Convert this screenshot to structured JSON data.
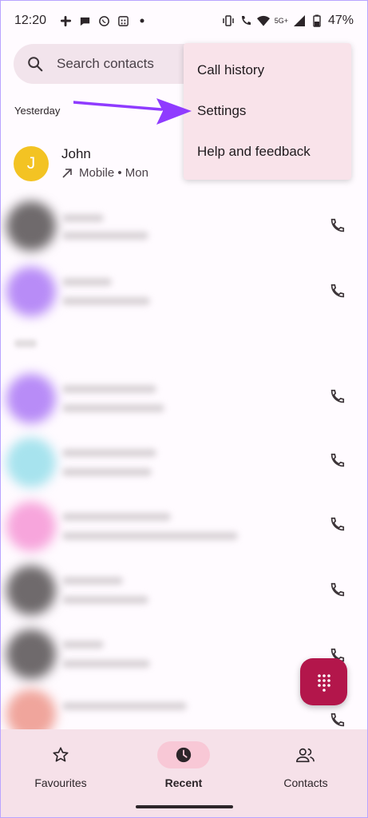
{
  "status_bar": {
    "time": "12:20",
    "network": "5G+",
    "battery": "47%",
    "icons_left": [
      "slack-icon",
      "chat-icon",
      "whatsapp-icon",
      "calendar-icon",
      "dot-icon"
    ],
    "icons_right": [
      "vibrate-icon",
      "wifi-calling-icon",
      "wifi-icon",
      "signal-icon",
      "battery-icon"
    ]
  },
  "search": {
    "placeholder": "Search contacts"
  },
  "section_label": "Yesterday",
  "recent_call": {
    "initial": "J",
    "name": "John",
    "detail": "Mobile • Mon",
    "avatar_color": "#f3c323"
  },
  "menu": {
    "items": [
      "Call history",
      "Settings",
      "Help and feedback"
    ]
  },
  "bottom_nav": {
    "items": [
      {
        "label": "Favourites",
        "icon": "star-icon"
      },
      {
        "label": "Recent",
        "icon": "clock-icon",
        "active": true
      },
      {
        "label": "Contacts",
        "icon": "people-icon"
      }
    ]
  },
  "colors": {
    "fab": "#b3164b",
    "menu_bg": "#f9e3ea",
    "nav_bg": "#f6e1e9",
    "annotation_arrow": "#8f3bff"
  }
}
